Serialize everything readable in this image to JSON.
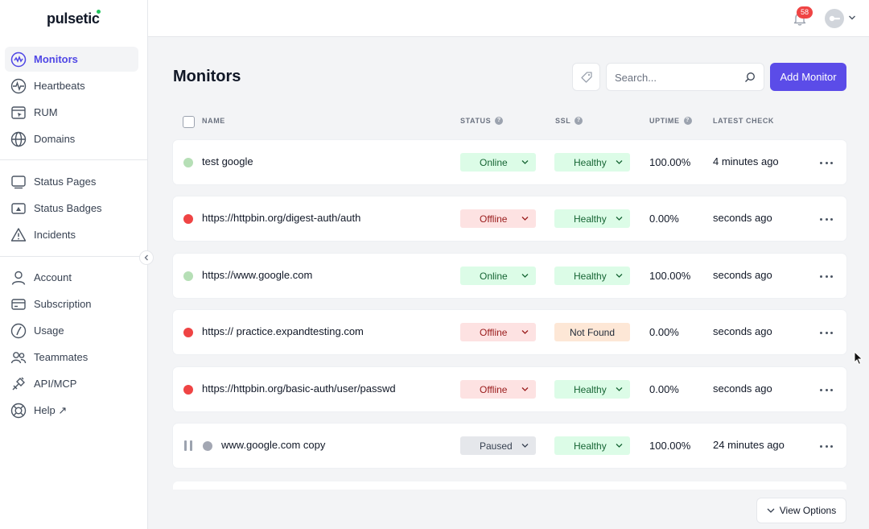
{
  "app": {
    "brand": "pulsetic"
  },
  "sidebar": {
    "items": [
      {
        "label": "Monitors",
        "icon": "monitors-icon",
        "active": true
      },
      {
        "label": "Heartbeats",
        "icon": "heartbeat-icon"
      },
      {
        "label": "RUM",
        "icon": "rum-icon"
      },
      {
        "label": "Domains",
        "icon": "globe-icon"
      },
      {
        "label": "Status Pages",
        "icon": "status-page-icon"
      },
      {
        "label": "Status Badges",
        "icon": "status-badge-icon"
      },
      {
        "label": "Incidents",
        "icon": "warning-icon"
      },
      {
        "label": "Account",
        "icon": "user-icon"
      },
      {
        "label": "Subscription",
        "icon": "credit-card-icon"
      },
      {
        "label": "Usage",
        "icon": "gauge-icon"
      },
      {
        "label": "Teammates",
        "icon": "team-icon"
      },
      {
        "label": "API/MCP",
        "icon": "plug-icon"
      },
      {
        "label": "Help ↗",
        "icon": "lifebuoy-icon"
      }
    ]
  },
  "topbar": {
    "notifications_count": "58"
  },
  "page": {
    "title": "Monitors",
    "search_placeholder": "Search...",
    "add_button": "Add Monitor",
    "view_options": "View Options"
  },
  "table": {
    "headers": {
      "name": "NAME",
      "status": "STATUS",
      "ssl": "SSL",
      "uptime": "UPTIME",
      "latest_check": "LATEST CHECK"
    },
    "rows": [
      {
        "name": "test google",
        "status": "Online",
        "ssl": "Healthy",
        "uptime": "100.00%",
        "latest_check": "4 minutes ago"
      },
      {
        "name": "https://httpbin.org/digest-auth/auth",
        "status": "Offline",
        "ssl": "Healthy",
        "uptime": "0.00%",
        "latest_check": "seconds ago"
      },
      {
        "name": "https://www.google.com",
        "status": "Online",
        "ssl": "Healthy",
        "uptime": "100.00%",
        "latest_check": "seconds ago"
      },
      {
        "name": "https:// practice.expandtesting.com",
        "status": "Offline",
        "ssl": "Not Found",
        "uptime": "0.00%",
        "latest_check": "seconds ago"
      },
      {
        "name": "https://httpbin.org/basic-auth/user/passwd",
        "status": "Offline",
        "ssl": "Healthy",
        "uptime": "0.00%",
        "latest_check": "seconds ago"
      },
      {
        "name": "www.google.com copy",
        "status": "Paused",
        "ssl": "Healthy",
        "uptime": "100.00%",
        "latest_check": "24 minutes ago"
      }
    ]
  },
  "colors": {
    "accent": "#5b4ce8",
    "online_bg": "#dcfce7",
    "online_text": "#166534",
    "offline_bg": "#fde2e2",
    "offline_text": "#991b1b",
    "paused_bg": "#e5e7eb",
    "ssl_notfound_bg": "#fde7d6",
    "dot_online": "#b6dfb6",
    "dot_offline": "#ef4444",
    "dot_paused": "#a3a7b3"
  }
}
